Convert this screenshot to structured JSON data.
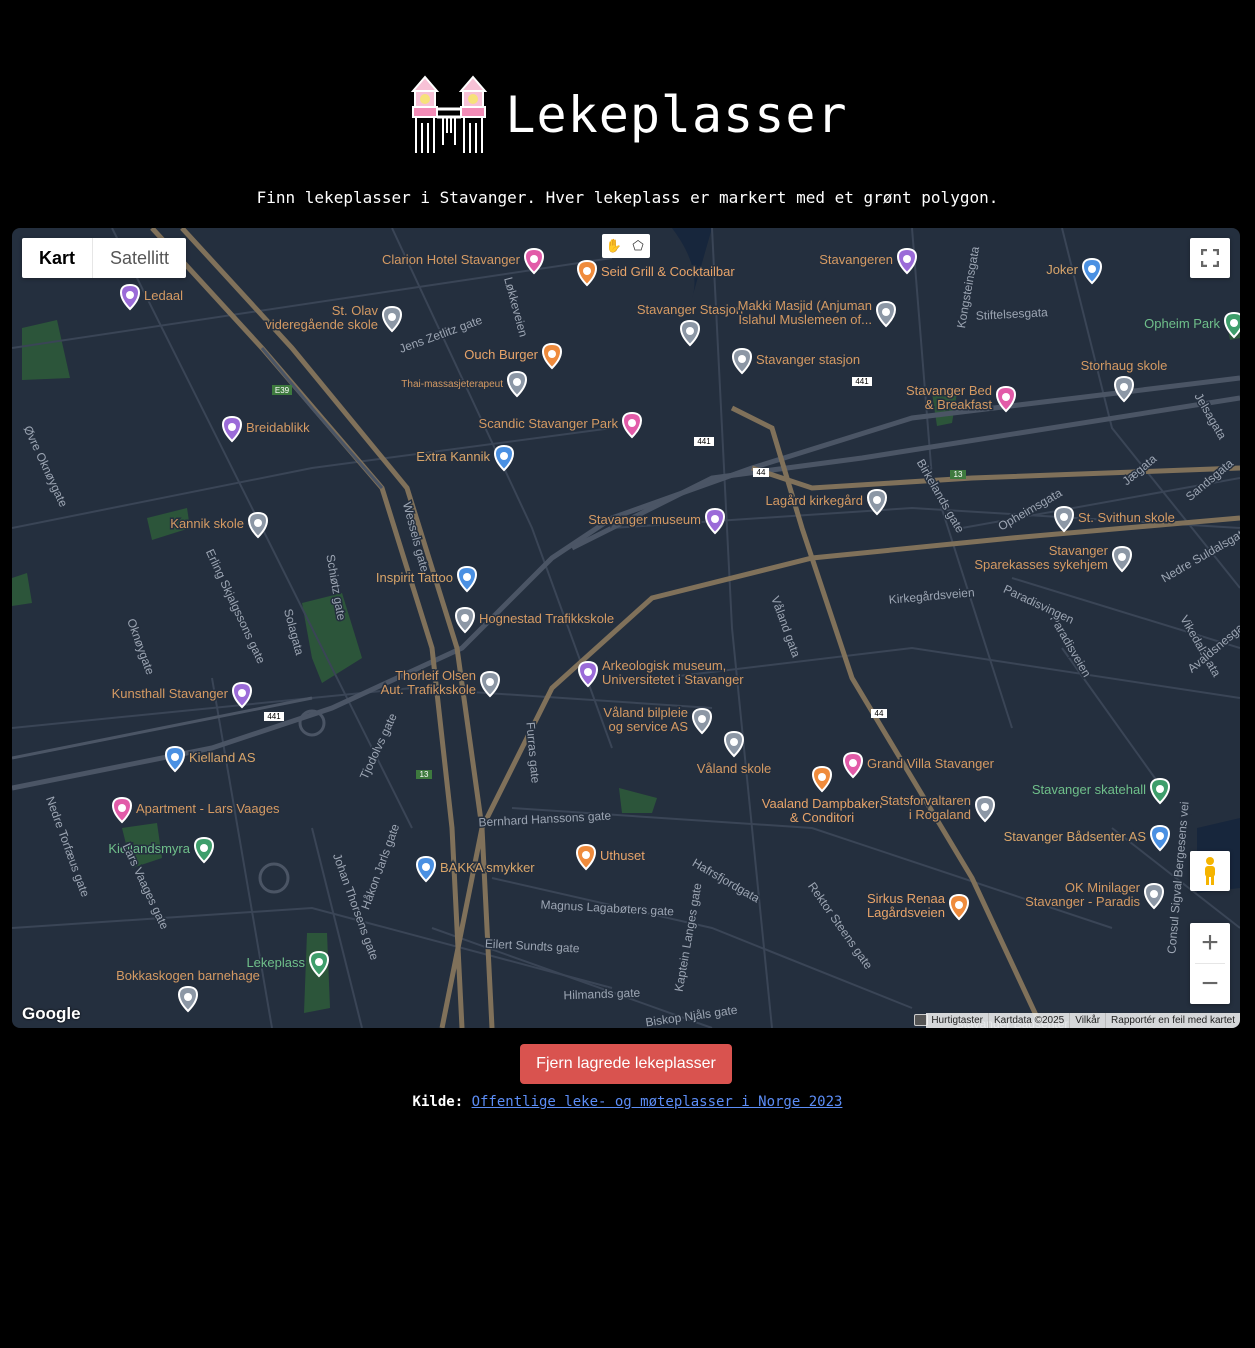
{
  "header": {
    "title": "Lekeplasser"
  },
  "subtitle": "Finn lekeplasser i Stavanger. Hver lekeplass er markert med et grønt polygon.",
  "map": {
    "map_types": [
      "Kart",
      "Satellitt"
    ],
    "attribution": {
      "shortcuts": "Hurtigtaster",
      "data": "Kartdata ©2025",
      "terms": "Vilkår",
      "report": "Rapportér en feil med kartet"
    },
    "logo": "Google",
    "poi": [
      {
        "name": "Clarion Hotel Stavanger",
        "icon": "hotel-icon",
        "color": "#e25ba8"
      },
      {
        "name": "Seid Grill & Cocktailbar",
        "icon": "restaurant-icon",
        "color": "#ef8b3c"
      },
      {
        "name": "Stavangeren",
        "icon": "theater-icon",
        "color": "#9b6bd8"
      },
      {
        "name": "Joker",
        "icon": "shop-icon",
        "color": "#4a90e2"
      },
      {
        "name": "Ledaal",
        "icon": "museum-icon",
        "color": "#9b6bd8"
      },
      {
        "name": "St. Olav videregående skole",
        "icon": "school-icon",
        "color": "#8c97a5"
      },
      {
        "name": "Stavanger Stasjon",
        "icon": "train-icon",
        "color": "#8c97a5"
      },
      {
        "name": "Makki Masjid (Anjuman Islahul Muslemeen of...",
        "icon": "mosque-icon",
        "color": "#8c97a5"
      },
      {
        "name": "Opheim Park",
        "icon": "park-icon",
        "color": "#3e9e6b"
      },
      {
        "name": "Ouch Burger",
        "icon": "restaurant-icon",
        "color": "#ef8b3c"
      },
      {
        "name": "Stavanger stasjon",
        "icon": "train-icon",
        "color": "#8c97a5"
      },
      {
        "name": "Storhaug skole",
        "icon": "school-icon",
        "color": "#8c97a5"
      },
      {
        "name": "Thai-massasjeterapeut",
        "icon": "pin-icon",
        "color": "#8c97a5"
      },
      {
        "name": "Stavanger Bed & Breakfast",
        "icon": "hotel-icon",
        "color": "#e25ba8"
      },
      {
        "name": "Breidablikk",
        "icon": "museum-icon",
        "color": "#9b6bd8"
      },
      {
        "name": "Scandic Stavanger Park",
        "icon": "hotel-icon",
        "color": "#e25ba8"
      },
      {
        "name": "Extra Kannik",
        "icon": "shop-icon",
        "color": "#4a90e2"
      },
      {
        "name": "Lagård kirkegård",
        "icon": "cemetery-icon",
        "color": "#8c97a5"
      },
      {
        "name": "Kannik skole",
        "icon": "school-icon",
        "color": "#8c97a5"
      },
      {
        "name": "Stavanger museum",
        "icon": "museum-icon",
        "color": "#9b6bd8"
      },
      {
        "name": "St. Svithun skole",
        "icon": "school-icon",
        "color": "#8c97a5"
      },
      {
        "name": "Stavanger Sparekasses sykehjem",
        "icon": "pin-icon",
        "color": "#8c97a5"
      },
      {
        "name": "Inspirit Tattoo",
        "icon": "shop-icon",
        "color": "#4a90e2"
      },
      {
        "name": "Hognestad Trafikkskole",
        "icon": "pin-icon",
        "color": "#8c97a5"
      },
      {
        "name": "Arkeologisk museum, Universitetet i Stavanger",
        "icon": "museum-icon",
        "color": "#9b6bd8"
      },
      {
        "name": "Thorleif Olsen Aut. Trafikkskole",
        "icon": "pin-icon",
        "color": "#8c97a5"
      },
      {
        "name": "Kunsthall Stavanger",
        "icon": "museum-icon",
        "color": "#9b6bd8"
      },
      {
        "name": "Våland bilpleie og service AS",
        "icon": "pin-icon",
        "color": "#8c97a5"
      },
      {
        "name": "Våland skole",
        "icon": "school-icon",
        "color": "#8c97a5"
      },
      {
        "name": "Kielland AS",
        "icon": "shop-icon",
        "color": "#4a90e2"
      },
      {
        "name": "Grand Villa Stavanger",
        "icon": "hotel-icon",
        "color": "#e25ba8"
      },
      {
        "name": "Stavanger skatehall",
        "icon": "pin-icon",
        "color": "#3e9e6b"
      },
      {
        "name": "Apartment - Lars Vaages",
        "icon": "hotel-icon",
        "color": "#e25ba8"
      },
      {
        "name": "Vaaland Dampbakeri & Conditori",
        "icon": "restaurant-icon",
        "color": "#ef8b3c"
      },
      {
        "name": "Statsforvaltaren i Rogaland",
        "icon": "government-icon",
        "color": "#8c97a5"
      },
      {
        "name": "Stavanger Bådsenter AS",
        "icon": "shop-icon",
        "color": "#4a90e2"
      },
      {
        "name": "Kiellandsmyra",
        "icon": "pin-icon",
        "color": "#3e9e6b"
      },
      {
        "name": "Uthuset",
        "icon": "restaurant-icon",
        "color": "#ef8b3c"
      },
      {
        "name": "BAKKA smykker",
        "icon": "shop-icon",
        "color": "#4a90e2"
      },
      {
        "name": "OK Minilager Stavanger - Paradis",
        "icon": "pin-icon",
        "color": "#8c97a5"
      },
      {
        "name": "Sirkus Renaa Lagårdsveien",
        "icon": "restaurant-icon",
        "color": "#ef8b3c"
      },
      {
        "name": "Lekeplass",
        "icon": "park-icon",
        "color": "#3e9e6b"
      },
      {
        "name": "Bokkaskogen barnehage",
        "icon": "school-icon",
        "color": "#8c97a5"
      }
    ],
    "street_labels": [
      "Jens Zetlitz gate",
      "Løkkeveien",
      "Øvre Oknøygate",
      "Wessels gate",
      "Schiøtz gate",
      "Erling Skjalgssons gate",
      "Oknøygate",
      "Solagata",
      "Tjodolvs gate",
      "Furras gate",
      "Bernhard Hanssons gate",
      "Nedre Torfæus gate",
      "Lars Vaages gate",
      "Johan Thorsens gate",
      "Håkon Jarls gate",
      "Magnus Lagabøters gate",
      "Eilert Sundts gate",
      "Hilmands gate",
      "Hafrsfjordgata",
      "Kaptein Langes gate",
      "Rektor Steens gate",
      "Biskop Njåls gate",
      "Kirkegårdsveien",
      "Paradisveien",
      "Paradisvingen",
      "Vikedalsgata",
      "Jelsagata",
      "Jægata",
      "Sandsgata",
      "Opheimsgata",
      "Birkelands gate",
      "Stiftelsesgata",
      "Kongsteinsgata",
      "Nedre Suldalsgate",
      "Avaldsnesgata",
      "Våland gata",
      "Consul Sigval Bergesens vei",
      "Stavanger Bådsenter"
    ],
    "road_shields": [
      "E39",
      "441",
      "441",
      "441",
      "44",
      "44",
      "13",
      "13"
    ]
  },
  "actions": {
    "clear_button": "Fjern lagrede lekeplasser"
  },
  "source": {
    "label": "Kilde:",
    "link_text": "Offentlige leke- og møteplasser i Norge 2023"
  }
}
